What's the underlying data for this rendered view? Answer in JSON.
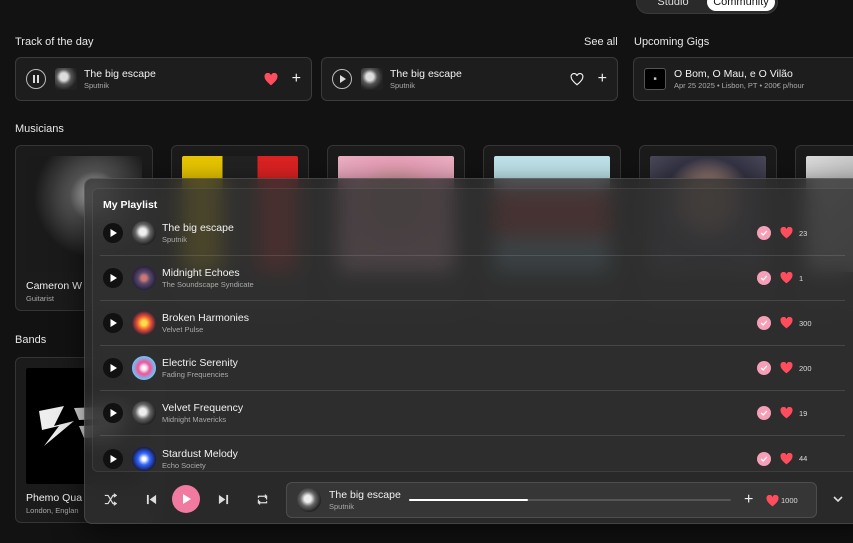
{
  "tabs": [
    {
      "label": "Studio",
      "active": false
    },
    {
      "label": "Community",
      "active": true
    }
  ],
  "sections": {
    "track_of_day": "Track of the day",
    "see_all": "See all",
    "upcoming_gigs": "Upcoming Gigs",
    "musicians": "Musicians",
    "bands": "Bands"
  },
  "track_cards": [
    {
      "title": "The big escape",
      "artist": "Sputnik",
      "playing": true,
      "liked": true
    },
    {
      "title": "The big escape",
      "artist": "Sputnik",
      "playing": false,
      "liked": false
    }
  ],
  "gig": {
    "title": "O Bom, O Mau, e O Vilão",
    "details": "Apr 25 2025 • Lisbon, PT • 200€ p/hour"
  },
  "musician": {
    "name": "Cameron W",
    "role": "Guitarist"
  },
  "band": {
    "name": "Phemo Qua",
    "location": "London, Englan"
  },
  "playlist": {
    "title": "My Playlist",
    "items": [
      {
        "title": "The big escape",
        "artist": "Sputnik",
        "likes": "23"
      },
      {
        "title": "Midnight Echoes",
        "artist": "The Soundscape Syndicate",
        "likes": "1"
      },
      {
        "title": "Broken Harmonies",
        "artist": "Velvet Pulse",
        "likes": "300"
      },
      {
        "title": "Electric Serenity",
        "artist": "Fading Frequencies",
        "likes": "200"
      },
      {
        "title": "Velvet Frequency",
        "artist": "Midnight Mavericks",
        "likes": "19"
      },
      {
        "title": "Stardust Melody",
        "artist": "Echo Society",
        "likes": "44"
      }
    ]
  },
  "player": {
    "title": "The big escape",
    "artist": "Sputnik",
    "likes": "1000",
    "progress": 0.37
  },
  "colors": {
    "accent": "#f07aa0",
    "heart": "#ff4d5e",
    "check": "#f5a0b8"
  }
}
